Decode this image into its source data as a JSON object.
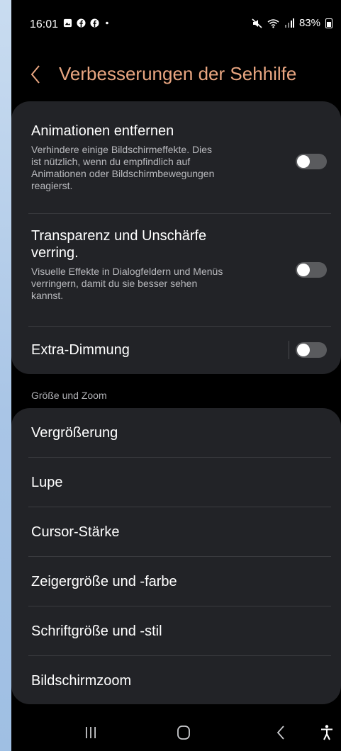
{
  "status_bar": {
    "time": "16:01",
    "battery": "83%",
    "icons": [
      "gallery-icon",
      "facebook-icon",
      "facebook-icon",
      "dot-icon",
      "mute-icon",
      "wifi-icon",
      "signal-icon",
      "battery-icon"
    ]
  },
  "header": {
    "back_icon": "chevron-left-icon",
    "title": "Verbesserungen der Sehhilfe"
  },
  "settings": [
    {
      "title": "Animationen entfernen",
      "description_lines": [
        "Verhindere einige Bildschirmeffekte. Dies",
        "ist nützlich, wenn du empfindlich auf",
        "Animationen oder Bildschirmbewegungen",
        "reagierst."
      ],
      "enabled": false
    },
    {
      "title_lines": [
        "Transparenz und Unschärfe",
        "verring."
      ],
      "description_lines": [
        "Visuelle Effekte in Dialogfeldern und Menüs",
        "verringern, damit du sie besser sehen",
        "kannst."
      ],
      "enabled": false
    },
    {
      "title": "Extra-Dimmung",
      "enabled": false
    }
  ],
  "section": {
    "header": "Größe und Zoom",
    "items": [
      "Vergrößerung",
      "Lupe",
      "Cursor-Stärke",
      "Zeigergröße und -farbe",
      "Schriftgröße und -stil",
      "Bildschirmzoom"
    ]
  },
  "nav_bar": [
    "recent-apps-icon",
    "home-icon",
    "back-icon",
    "accessibility-icon"
  ],
  "colors": {
    "accent": "#e9a681",
    "card": "#222327",
    "background": "#000000",
    "toggle_off": "#5a5b5e"
  }
}
